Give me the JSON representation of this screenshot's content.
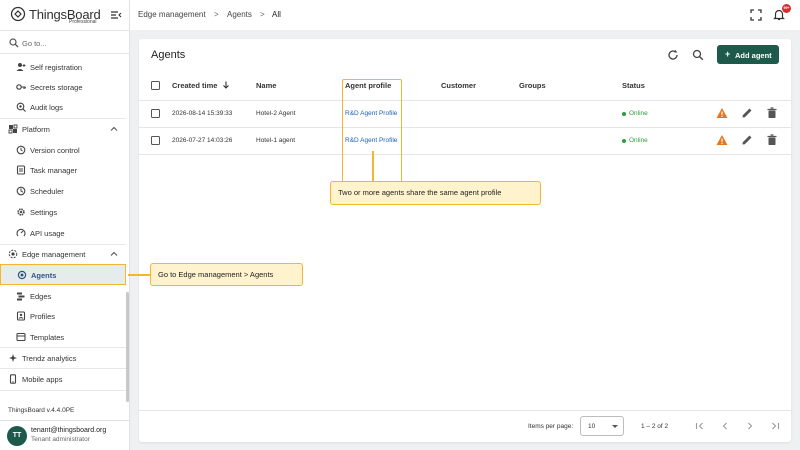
{
  "app": {
    "logo_text": "ThingsBoard",
    "logo_sub": "Professional",
    "version": "ThingsBoard v.4.4.0PE"
  },
  "sidebar": {
    "search_label": "Go to...",
    "items": [
      {
        "label": "Self registration",
        "icon": "person-add-icon"
      },
      {
        "label": "Secrets storage",
        "icon": "key-icon"
      },
      {
        "label": "Audit logs",
        "icon": "audit-icon"
      },
      {
        "label": "Platform",
        "icon": "platform-icon"
      },
      {
        "label": "Version control",
        "icon": "history-icon"
      },
      {
        "label": "Task manager",
        "icon": "task-icon"
      },
      {
        "label": "Scheduler",
        "icon": "clock-icon"
      },
      {
        "label": "Settings",
        "icon": "gear-icon"
      },
      {
        "label": "API usage",
        "icon": "api-icon"
      },
      {
        "label": "Edge management",
        "icon": "edge-icon"
      },
      {
        "label": "Agents",
        "icon": "agent-icon"
      },
      {
        "label": "Edges",
        "icon": "edges-icon"
      },
      {
        "label": "Profiles",
        "icon": "profile-icon"
      },
      {
        "label": "Templates",
        "icon": "template-icon"
      },
      {
        "label": "Trendz analytics",
        "icon": "trendz-icon"
      },
      {
        "label": "Mobile apps",
        "icon": "mobile-icon"
      }
    ]
  },
  "user": {
    "initials": "TT",
    "email": "tenant@thingsboard.org",
    "role": "Tenant administrator"
  },
  "topbar": {
    "breadcrumb": [
      "Edge management",
      "Agents",
      "All"
    ],
    "separator": ">",
    "notification_badge": "99+"
  },
  "main": {
    "title": "Agents",
    "add_button_label": "Add agent",
    "columns": [
      "Created time",
      "Name",
      "Agent profile",
      "Customer",
      "Groups",
      "Status"
    ],
    "rows": [
      {
        "created": "2026-08-14 15:39:33",
        "name": "Hotel-2 Agent",
        "profile": "R&D Agent Profile",
        "customer": "",
        "groups": "",
        "status": "Online"
      },
      {
        "created": "2026-07-27 14:03:26",
        "name": "Hotel-1 agent",
        "profile": "R&D Agent Profile",
        "customer": "",
        "groups": "",
        "status": "Online"
      }
    ],
    "pager": {
      "items_per_page_label": "Items per page:",
      "items_per_page": "10",
      "range": "1 – 2 of 2"
    }
  },
  "callouts": {
    "profile_note": "Two or more agents share the same agent profile",
    "nav_note": "Go to Edge management > Agents"
  },
  "colors": {
    "accent": "#1e5a4c",
    "highlight": "#f2b632",
    "callout_bg": "#fff3cd",
    "online": "#2e9d3b",
    "link": "#2062b5",
    "warning": "#e8761f"
  }
}
